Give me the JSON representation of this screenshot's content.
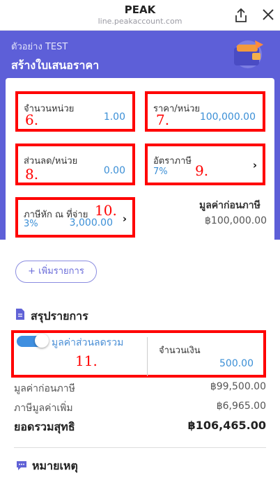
{
  "topbar": {
    "title": "PEAK",
    "url": "line.peakaccount.com"
  },
  "header": {
    "sub": "ตัวอย่าง TEST",
    "heading": "สร้างใบเสนอราคา"
  },
  "fields": {
    "qty": {
      "label": "จำนวนหน่วย",
      "value": "1.00",
      "marker": "6."
    },
    "price": {
      "label": "ราคา/หน่วย",
      "value": "100,000.00",
      "marker": "7."
    },
    "discount": {
      "label": "ส่วนลด/หน่วย",
      "value": "0.00",
      "marker": "8."
    },
    "taxrate": {
      "label": "อัตราภาษี",
      "value": "7%",
      "marker": "9."
    },
    "wht": {
      "label": "ภาษีหัก ณ ที่จ่าย",
      "pct": "3%",
      "value": "3,000.00",
      "marker": "10."
    }
  },
  "pretax": {
    "label": "มูลค่าก่อนภาษี",
    "value": "฿100,000.00"
  },
  "add_item": "+ เพิ่มรายการ",
  "summary": {
    "title": "สรุปรายการ",
    "discount_toggle": "มูลค่าส่วนลดรวม",
    "amount_label": "จำนวนเงิน",
    "amount_value": "500.00",
    "marker": "11.",
    "rows": [
      {
        "label": "มูลค่าก่อนภาษี",
        "value": "฿99,500.00"
      },
      {
        "label": "ภาษีมูลค่าเพิ่ม",
        "value": "฿6,965.00"
      },
      {
        "label": "ยอดรวมสุทธิ",
        "value": "฿106,465.00"
      }
    ]
  },
  "notes": {
    "title": "หมายเหตุ"
  }
}
